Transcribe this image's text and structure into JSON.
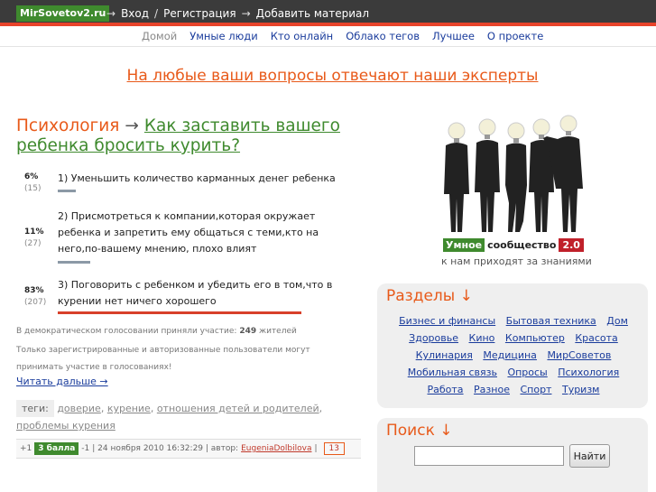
{
  "topbar": {
    "logo": "MirSovetov2.ru",
    "arrow1": "→",
    "login": "Вход",
    "slash": "/",
    "register": "Регистрация",
    "arrow2": "→",
    "add": "Добавить материал"
  },
  "subnav": {
    "home": "Домой",
    "items": [
      "Умные люди",
      "Кто онлайн",
      "Облако тегов",
      "Лучшее",
      "О проекте"
    ]
  },
  "banner": "На любые ваши вопросы отвечают наши эксперты",
  "article": {
    "category": "Психология",
    "arrow": "→",
    "title": "Как заставить вашего ребенка бросить курить?"
  },
  "poll": {
    "options": [
      {
        "pct": "6%",
        "count": "(15)",
        "text": "1) Уменьшить количество карманных денег ребенка",
        "share": 6
      },
      {
        "pct": "11%",
        "count": "(27)",
        "text": "2) Присмотреться к компании,которая окружает ребенка и запретить ему общаться с теми,кто на него,по-вашему мнению, плохо влият",
        "share": 11
      },
      {
        "pct": "83%",
        "count": "(207)",
        "text": "3) Поговорить с ребенком и убедить его в том,что в курении нет ничего хорошего",
        "share": 83
      }
    ],
    "participants_prefix": "В демократическом голосовании приняли участие:",
    "participants_count": "249",
    "participants_suffix": "жителей",
    "restriction": "Только зарегистрированные и авторизованные пользователи могут принимать участие в голосованиях!"
  },
  "read_more": "Читать дальше →",
  "tags": {
    "label": "теги:",
    "items": [
      "доверие",
      "курение",
      "отношения детей и родителей",
      "проблемы курения"
    ]
  },
  "meta": {
    "plus": "+1",
    "score": "3 балла",
    "minus": "-1",
    "date": "| 24 ноября 2010 16:32:29 | автор:",
    "author": "EugeniaDolbilova",
    "pipe": "|",
    "comments": "13"
  },
  "community": {
    "b1": "Умное",
    "b2": "сообщество",
    "b3": "2.0",
    "sub": "к нам приходят за знаниями"
  },
  "sections": {
    "title": "Разделы ↓",
    "items": [
      "Бизнес и финансы",
      "Бытовая техника",
      "Дом",
      "Здоровье",
      "Кино",
      "Компьютер",
      "Красота",
      "Кулинария",
      "Медицина",
      "МирСоветов",
      "Мобильная связь",
      "Опросы",
      "Психология",
      "Работа",
      "Разное",
      "Спорт",
      "Туризм"
    ]
  },
  "search": {
    "title": "Поиск ↓",
    "value": "",
    "button": "Найти"
  },
  "colors": {
    "accent": "#e85a1a",
    "brand_green": "#3f8a2e",
    "topbar": "#3b3b3b",
    "link": "#1a3c9c"
  }
}
